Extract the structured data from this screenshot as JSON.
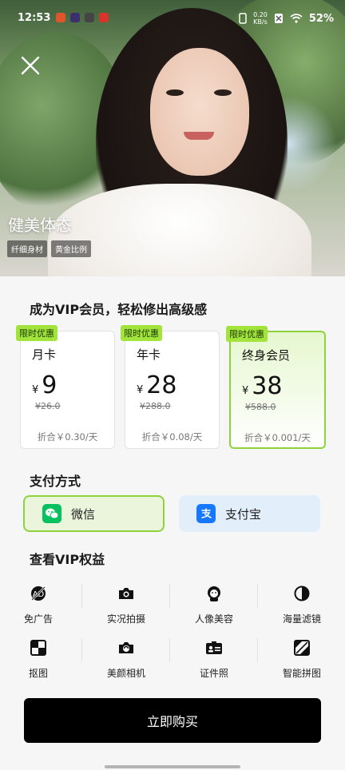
{
  "status_bar": {
    "time": "12:53",
    "net_speed_value": "0.20",
    "net_speed_unit": "KB/s",
    "battery": "52%"
  },
  "hero": {
    "title": "健美体态",
    "tags": [
      "纤细身材",
      "黄金比例"
    ]
  },
  "plans_heading": "成为VIP会员，轻松修出高级感",
  "plans": [
    {
      "badge": "限时优惠",
      "name": "月卡",
      "currency": "¥",
      "price": "9",
      "original": "¥26.0",
      "per_day": "折合￥0.30/天",
      "selected": false
    },
    {
      "badge": "限时优惠",
      "name": "年卡",
      "currency": "¥",
      "price": "28",
      "original": "¥288.0",
      "per_day": "折合￥0.08/天",
      "selected": false
    },
    {
      "badge": "限时优惠",
      "name": "终身会员",
      "currency": "¥",
      "price": "38",
      "original": "¥588.0",
      "per_day": "折合￥0.001/天",
      "selected": true
    }
  ],
  "payment": {
    "heading": "支付方式",
    "options": [
      {
        "label": "微信",
        "icon": "wechat-icon",
        "color": "#07c160",
        "selected": true
      },
      {
        "label": "支付宝",
        "icon": "alipay-icon",
        "color": "#1677ff",
        "selected": false
      }
    ]
  },
  "benefits": {
    "heading": "查看VIP权益",
    "items": [
      {
        "label": "免广告",
        "icon": "no-ads-icon"
      },
      {
        "label": "实况拍摄",
        "icon": "camera-icon"
      },
      {
        "label": "人像美容",
        "icon": "portrait-icon"
      },
      {
        "label": "海量滤镜",
        "icon": "filter-icon"
      },
      {
        "label": "抠图",
        "icon": "cutout-icon"
      },
      {
        "label": "美颜相机",
        "icon": "beauty-camera-icon"
      },
      {
        "label": "证件照",
        "icon": "id-photo-icon"
      },
      {
        "label": "智能拼图",
        "icon": "collage-icon"
      }
    ]
  },
  "buy_button": "立即购买",
  "colors": {
    "accent_green": "#8ed33b",
    "badge_green": "#a2e33c",
    "buy_button": "#000000"
  }
}
